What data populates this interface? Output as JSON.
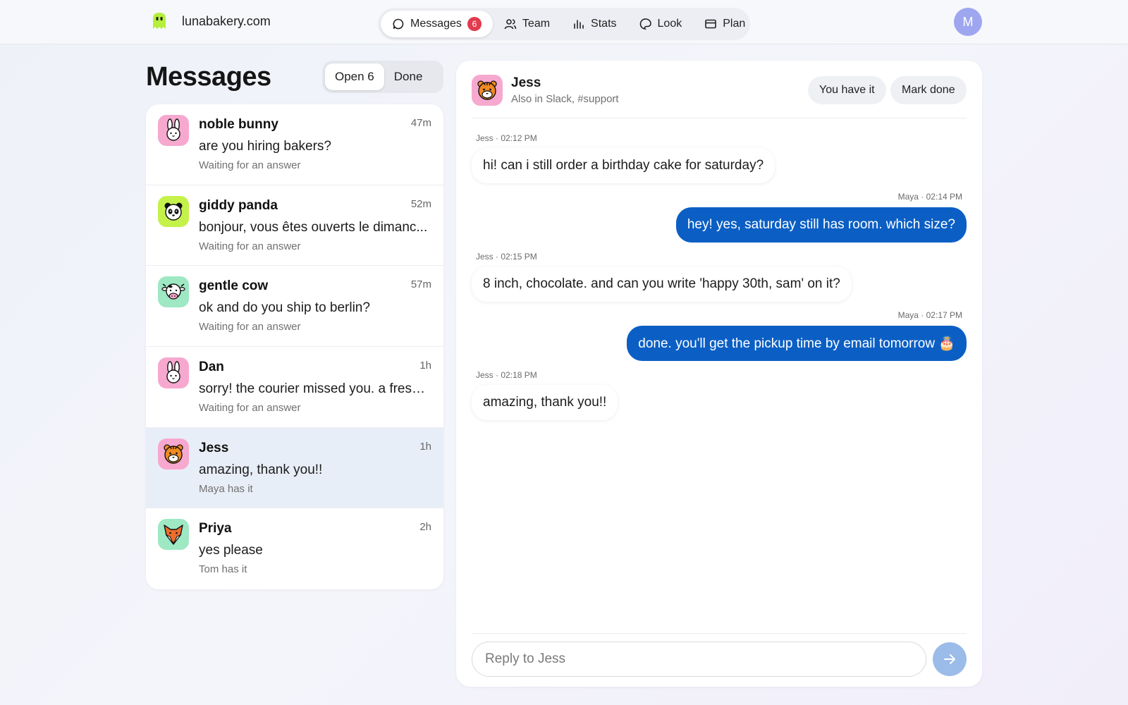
{
  "brand": {
    "name": "lunabakery.com",
    "logo": "ghost-logo-icon"
  },
  "nav": {
    "items": [
      {
        "label": "Messages",
        "icon": "chat-bubble-icon",
        "badge": "6",
        "active": true
      },
      {
        "label": "Team",
        "icon": "people-icon"
      },
      {
        "label": "Stats",
        "icon": "bar-chart-icon"
      },
      {
        "label": "Look",
        "icon": "palette-icon"
      },
      {
        "label": "Plan",
        "icon": "card-icon"
      }
    ]
  },
  "user": {
    "initial": "M"
  },
  "inbox": {
    "title": "Messages",
    "segments": {
      "open": "Open 6",
      "done": "Done"
    },
    "conversations": [
      {
        "name": "noble bunny",
        "time": "47m",
        "preview": "are you hiring bakers?",
        "status": "Waiting for an answer",
        "avatar": "bunny-icon",
        "avatar_bg": "#f7a8cf"
      },
      {
        "name": "giddy panda",
        "time": "52m",
        "preview": "bonjour, vous êtes ouverts le dimanc...",
        "status": "Waiting for an answer",
        "avatar": "panda-icon",
        "avatar_bg": "#c4f24a"
      },
      {
        "name": "gentle cow",
        "time": "57m",
        "preview": "ok and do you ship to berlin?",
        "status": "Waiting for an answer",
        "avatar": "cow-icon",
        "avatar_bg": "#9ee8c4"
      },
      {
        "name": "Dan",
        "time": "1h",
        "preview": "sorry! the courier missed you. a fresh ...",
        "status": "Waiting for an answer",
        "avatar": "bunny-icon",
        "avatar_bg": "#f7a8cf"
      },
      {
        "name": "Jess",
        "time": "1h",
        "preview": "amazing, thank you!!",
        "status": "Maya has it",
        "avatar": "tiger-icon",
        "avatar_bg": "#f7a8cf",
        "selected": true
      },
      {
        "name": "Priya",
        "time": "2h",
        "preview": "yes please",
        "status": "Tom has it",
        "avatar": "fox-icon",
        "avatar_bg": "#9ee8c4"
      }
    ]
  },
  "chat": {
    "name": "Jess",
    "subtitle": "Also in Slack, #support",
    "actions": {
      "assigned": "You have it",
      "done": "Mark done"
    },
    "messages": [
      {
        "meta": "Jess · 02:12 PM",
        "text": "hi! can i still order a birthday cake for saturday?",
        "dir": "in"
      },
      {
        "meta": "Maya · 02:14 PM",
        "text": "hey! yes, saturday still has room. which size?",
        "dir": "out"
      },
      {
        "meta": "Jess · 02:15 PM",
        "text": "8 inch, chocolate. and can you write 'happy 30th, sam' on it?",
        "dir": "in"
      },
      {
        "meta": "Maya · 02:17 PM",
        "text": "done. you'll get the pickup time by email tomorrow 🎂",
        "dir": "out"
      },
      {
        "meta": "Jess · 02:18 PM",
        "text": "amazing, thank you!!",
        "dir": "in"
      }
    ],
    "reply_placeholder": "Reply to Jess",
    "send_icon": "arrow-right-icon"
  },
  "colors": {
    "accent": "#0b5fc4",
    "badge": "#e23a4e",
    "selected_row": "#e8eef7",
    "send_button": "#9bbce8"
  }
}
